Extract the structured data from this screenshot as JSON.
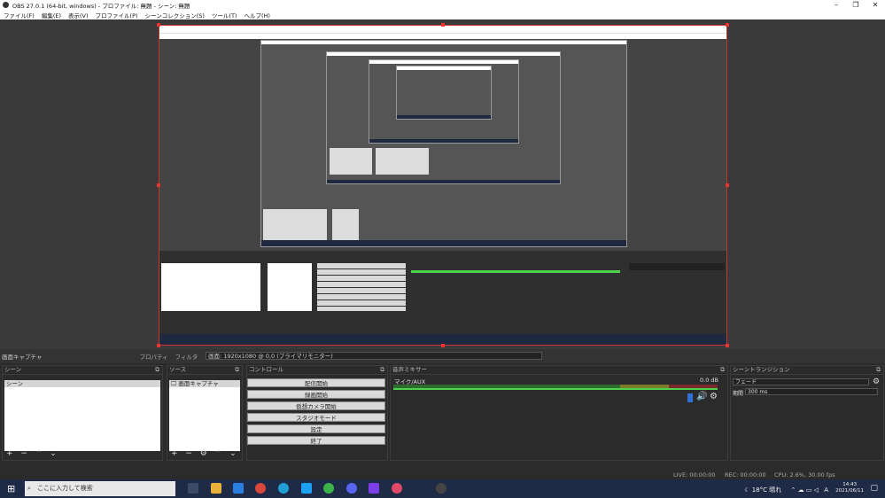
{
  "window": {
    "title": "OBS 27.0.1 (64-bit, windows) - プロファイル: 無題 - シーン: 無題",
    "menus": [
      "ファイル(F)",
      "編集(E)",
      "表示(V)",
      "プロファイル(P)",
      "シーンコレクション(S)",
      "ツール(T)",
      "ヘルプ(H)"
    ]
  },
  "scene_bar": {
    "current": "画面キャプチャ",
    "properties": "プロパティ",
    "filters": "フィルタ",
    "display_select": "画面: 1920x1080 @ 0,0 (プライマリモニター)"
  },
  "scenes": {
    "header": "シーン",
    "items": [
      "シーン"
    ]
  },
  "sources": {
    "header": "ソース",
    "items": [
      {
        "label": "画面キャプチャ"
      }
    ]
  },
  "controls": {
    "header": "コントロール",
    "buttons": [
      "配信開始",
      "録画開始",
      "仮想カメラ開始",
      "スタジオモード",
      "設定",
      "終了"
    ]
  },
  "mixer": {
    "header": "音声ミキサー",
    "track": "マイク/AUX",
    "level": "0.0 dB"
  },
  "transitions": {
    "header": "シーントランジション",
    "type": "フェード",
    "duration_label": "期間",
    "duration": "300 ms"
  },
  "status": {
    "live": "LIVE: 00:00:00",
    "rec": "REC: 00:00:00",
    "cpu": "CPU: 2.6%, 30.00 fps"
  },
  "taskbar": {
    "search_placeholder": "ここに入力して検索",
    "weather": "18°C 晴れ",
    "ime": "A",
    "time": "14:43",
    "date": "2021/06/11"
  },
  "colors": {
    "preview_border": "#cc3333",
    "taskbar": "#1f2b46"
  }
}
